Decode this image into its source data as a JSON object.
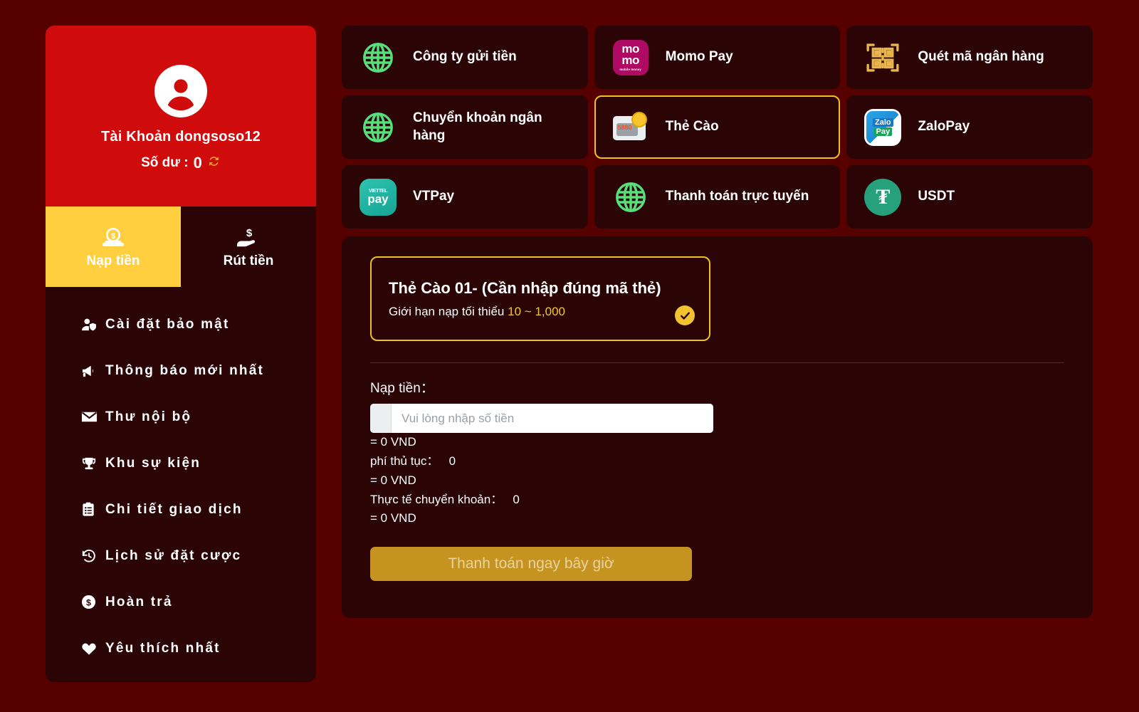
{
  "sidebar": {
    "profile": {
      "avatar_icon": "user-circle-icon",
      "name": "Tài Khoản dongsoso12",
      "balance_label": "Số dư :",
      "balance_value": "0",
      "refresh_icon": "refresh-icon"
    },
    "tabs": [
      {
        "label": "Nạp tiền",
        "icon": "deposit-coin-icon",
        "active": true
      },
      {
        "label": "Rút tiền",
        "icon": "withdraw-hand-icon",
        "active": false
      }
    ],
    "menu": [
      {
        "label": "Cài đặt bảo mật",
        "icon": "user-shield-icon"
      },
      {
        "label": "Thông báo mới nhất",
        "icon": "megaphone-icon"
      },
      {
        "label": "Thư nội bộ",
        "icon": "envelope-icon"
      },
      {
        "label": "Khu sự kiện",
        "icon": "trophy-icon"
      },
      {
        "label": "Chi tiết giao dịch",
        "icon": "clipboard-list-icon"
      },
      {
        "label": "Lịch sử đặt cược",
        "icon": "history-clock-icon"
      },
      {
        "label": "Hoàn trả",
        "icon": "dollar-circle-icon"
      },
      {
        "label": "Yêu thích nhất",
        "icon": "heart-icon"
      }
    ]
  },
  "methods": [
    {
      "label": "Công ty gửi tiền",
      "icon": "globe-icon",
      "selected": false
    },
    {
      "label": "Momo Pay",
      "icon": "momo-logo",
      "selected": false
    },
    {
      "label": "Quét mã ngân hàng",
      "icon": "qr-scan-icon",
      "selected": false
    },
    {
      "label": "Chuyển khoản ngân hàng",
      "icon": "globe-icon",
      "selected": false
    },
    {
      "label": "Thẻ Cào",
      "icon": "scratch-card-icon",
      "selected": true
    },
    {
      "label": "ZaloPay",
      "icon": "zalopay-logo",
      "selected": false
    },
    {
      "label": "VTPay",
      "icon": "viettelpay-logo",
      "selected": false
    },
    {
      "label": "Thanh toán trực tuyến",
      "icon": "globe-icon",
      "selected": false
    },
    {
      "label": "USDT",
      "icon": "usdt-logo",
      "selected": false
    }
  ],
  "panel": {
    "package": {
      "title": "Thẻ Cào 01- (Cần nhập đúng mã thẻ)",
      "limit_prefix": "Giới hạn nạp tối thiểu",
      "limit_min": "10",
      "limit_sep": "~",
      "limit_max": "1,000",
      "check_icon": "check-circle-icon",
      "selected": true
    },
    "form": {
      "amount_label": "Nạp tiền：",
      "amount_value": "",
      "amount_placeholder": "Vui lòng nhập số tiền",
      "converted_amount": "= 0 VND",
      "fee_label": "phí thủ tục：",
      "fee_value": "0",
      "fee_converted": "= 0 VND",
      "actual_label": "Thực tế chuyển khoản：",
      "actual_value": "0",
      "actual_converted": "= 0 VND",
      "submit_label": "Thanh toán ngay bây giờ"
    }
  },
  "colors": {
    "page_bg": "#560000",
    "card_bg": "#2b0505",
    "profile_red": "#d00b0b",
    "accent_yellow": "#ffcf3f",
    "border_gold": "#f0c020",
    "button_gold": "#c59420",
    "globe_green": "#57e07a"
  }
}
